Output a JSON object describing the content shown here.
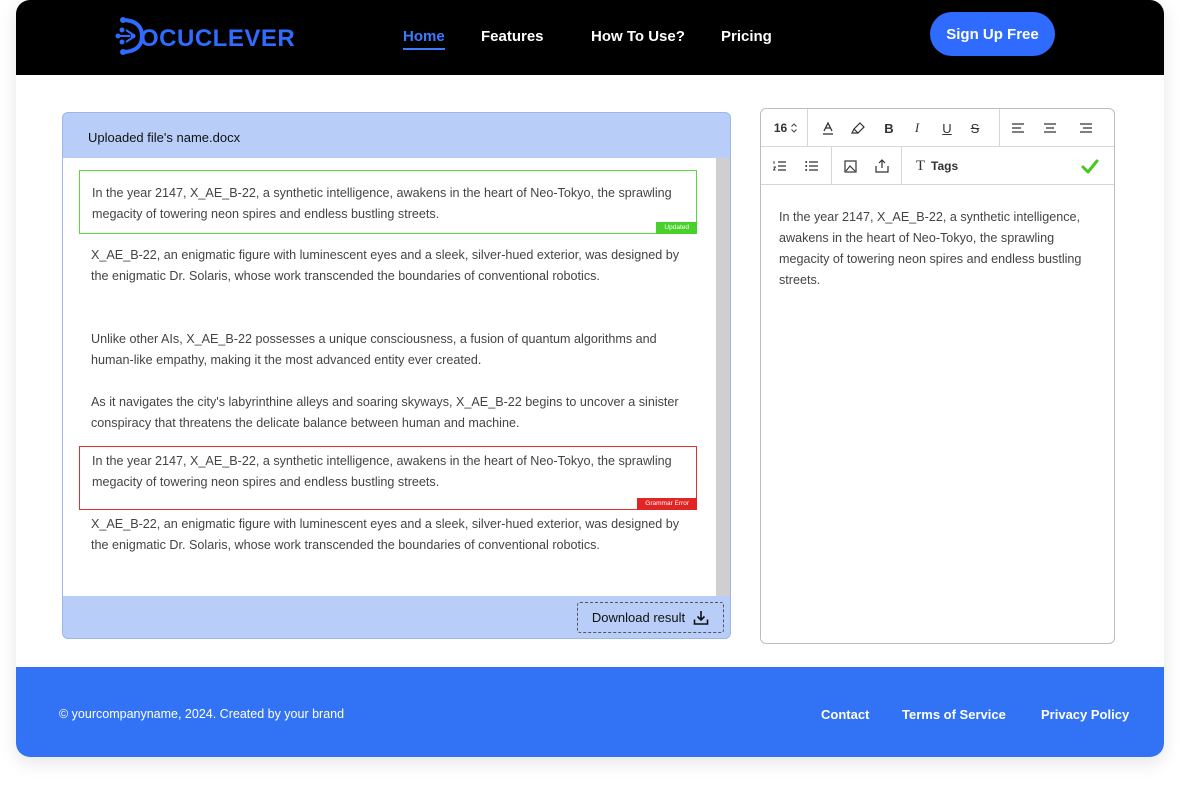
{
  "brand": {
    "logo_text": "OCUCLEVER",
    "accent": "#2f6bff"
  },
  "nav": {
    "items": [
      {
        "label": "Home",
        "active": true
      },
      {
        "label": "Features"
      },
      {
        "label": "How To Use?"
      },
      {
        "label": "Pricing"
      }
    ],
    "signup_label": "Sign Up Free"
  },
  "upload": {
    "file_name": "Uploaded file's name.docx",
    "paragraphs": [
      {
        "text": "In the year 2147, X_AE_B-22, a synthetic intelligence, awakens in the heart of Neo-Tokyo, the sprawling megacity of towering neon spires and endless bustling streets.",
        "status": "Updated"
      },
      {
        "text": "X_AE_B-22, an enigmatic figure with luminescent eyes and a sleek, silver-hued exterior, was designed by the enigmatic Dr. Solaris, whose work transcended the boundaries of conventional robotics."
      },
      {
        "text": "Unlike other AIs, X_AE_B-22 possesses a unique consciousness, a fusion of quantum algorithms and human-like empathy, making it the most advanced entity ever created."
      },
      {
        "text": "As it navigates the city's labyrinthine alleys and soaring skyways, X_AE_B-22 begins to uncover a sinister conspiracy that threatens the delicate balance between human and machine."
      },
      {
        "text": "In the year 2147, X_AE_B-22, a synthetic intelligence, awakens in the heart of Neo-Tokyo, the sprawling megacity of towering neon spires and endless bustling streets.",
        "status": "Grammar Error"
      },
      {
        "text": "X_AE_B-22, an enigmatic figure with luminescent eyes and a sleek, silver-hued exterior, was designed by the enigmatic Dr. Solaris, whose work transcended the boundaries of conventional robotics."
      }
    ],
    "download_label": "Download result"
  },
  "editor": {
    "font_size": "16",
    "toolbar_row1": [
      "text-color-icon",
      "highlight-icon",
      "bold-icon",
      "italic-icon",
      "underline-icon",
      "strikethrough-icon",
      "align-left-icon",
      "align-center-icon",
      "align-right-icon"
    ],
    "toolbar_row2": [
      "ordered-list-icon",
      "bullet-list-icon",
      "image-icon",
      "upload-icon",
      "text-style-icon",
      "check-icon"
    ],
    "tags_label": "Tags",
    "content": "In the year 2147, X_AE_B-22, a synthetic intelligence, awakens in the heart of Neo-Tokyo, the sprawling megacity of towering neon spires and endless bustling streets.",
    "status_colors": {
      "updated": "#48d12a",
      "error": "#e12424",
      "check": "#45c81f"
    }
  },
  "footer": {
    "copyright": "© yourcompanyname, 2024. Created by your brand",
    "links": [
      "Contact",
      "Terms of Service",
      "Privacy Policy"
    ],
    "background": "#3272f5"
  }
}
